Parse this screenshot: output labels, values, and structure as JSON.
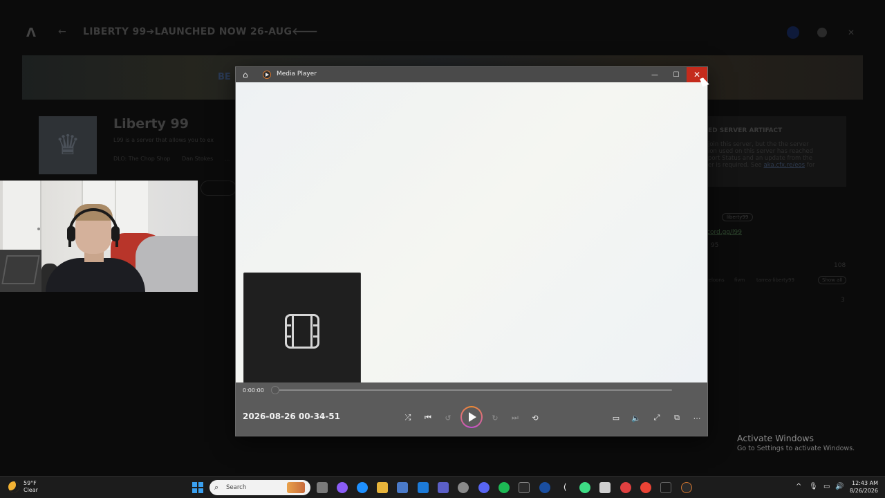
{
  "background_app": {
    "logo": "Λ",
    "back": "←",
    "title": "LIBERTY 99➔LAUNCHED NOW 26-AUG🡐",
    "banner_text": "BE",
    "server_name": "Liberty 99",
    "server_desc": "L99 is a server that allows you to ex",
    "tags": [
      "DLO: The Chop Shop",
      "Dan Stokes",
      "..."
    ],
    "artifact": {
      "title": "ED SERVER ARTIFACT",
      "lines": [
        "join this server, but the the server",
        "ion used on this server has reached",
        "port Status and an update from the",
        "er is required. See "
      ],
      "link": "aka.cfx.re/eos",
      "link_suffix": " for"
    },
    "right_tag": "liberty99",
    "right_link": "cord.gg/l99",
    "right_sub": "95",
    "count_1": "108",
    "count_2": "3",
    "chips": [
      "reloons",
      "fivm",
      "tarrea-liberty99"
    ],
    "show_all": "Show all"
  },
  "media_player": {
    "title": "Media Player",
    "current_time": "0:00:00",
    "progress_percent": 0,
    "filename": "2026-08-26 00-34-51",
    "window_buttons": {
      "minimize": "—",
      "maximize": "☐",
      "close": "✕"
    },
    "controls": {
      "shuffle": "⤮",
      "previous": "⏮",
      "skip_back": "↺",
      "skip_forward": "↻",
      "next": "⏭",
      "repeat": "⟲",
      "captions": "▭",
      "volume": "🔈",
      "fullscreen": "⤢",
      "miniplayer": "⧉",
      "more": "⋯"
    }
  },
  "activate_windows": {
    "title": "Activate Windows",
    "subtitle": "Go to Settings to activate Windows."
  },
  "taskbar": {
    "weather_temp": "59°F",
    "weather_desc": "Clear",
    "search_placeholder": "Search",
    "tray_chevron": "^",
    "tray_mic": "🎙",
    "tray_net": "▭",
    "tray_vol": "🔊",
    "time": "12:43 AM",
    "date": "8/26/2026",
    "app_icon_colors": [
      "#7a7a7a",
      "#8a5cf6",
      "#1e90ff",
      "#e8b43a",
      "#4a7ac9",
      "#1c7ad8",
      "#5b5fc7",
      "#8a8a8a",
      "#5865f2",
      "#1db954",
      "#2a2a2a",
      "#1a4ea0",
      "#ffffff",
      "#3ddc84",
      "#e04040",
      "#cfcfcf",
      "#ea4335",
      "#1a1a1a",
      "#2a2a2a"
    ]
  },
  "colors": {
    "close_button": "#c42b1c",
    "titlebar": "#4a4a4a",
    "controls_bar": "#5b5b5b",
    "play_ring_start": "#f08c2e",
    "play_ring_end": "#c64fd6",
    "windows_accent": "#3aa0f0"
  }
}
